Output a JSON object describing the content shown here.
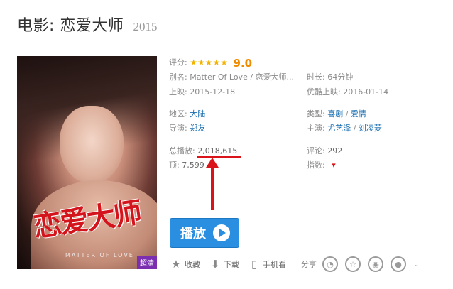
{
  "header": {
    "title": "电影: 恋爱大师",
    "year": "2015"
  },
  "poster": {
    "title_art": "恋爱大师",
    "subtitle_art": "MATTER OF LOVE",
    "quality_badge": "超清"
  },
  "info": {
    "rating_label": "评分:",
    "rating_stars": 4.5,
    "rating_score": "9.0",
    "alias_label": "别名:",
    "alias_value": "Matter Of Love / 恋爱大师...",
    "duration_label": "时长:",
    "duration_value": "64分钟",
    "release_label": "上映:",
    "release_value": "2015-12-18",
    "youku_release_label": "优酷上映:",
    "youku_release_value": "2016-01-14",
    "region_label": "地区:",
    "region_value": "大陆",
    "genre_label": "类型:",
    "genres": [
      "喜剧",
      "爱情"
    ],
    "director_label": "导演:",
    "director_value": "郑友",
    "cast_label": "主演:",
    "cast": [
      "尤艺泽",
      "刘凌菱"
    ],
    "plays_label": "总播放:",
    "plays_value": "2,018,615",
    "comments_label": "评论:",
    "comments_value": "292",
    "likes_label": "顶:",
    "likes_value": "7,599",
    "index_label": "指数:"
  },
  "play_button": {
    "label": "播放"
  },
  "actions": {
    "favorite_label": "收藏",
    "download_label": "下载",
    "mobile_label": "手机看",
    "share_label": "分享"
  },
  "colors": {
    "play_button_bg": "#2a8fe0",
    "link": "#1a6fb0",
    "rating": "#f08b00",
    "annotation": "#d9151b"
  }
}
